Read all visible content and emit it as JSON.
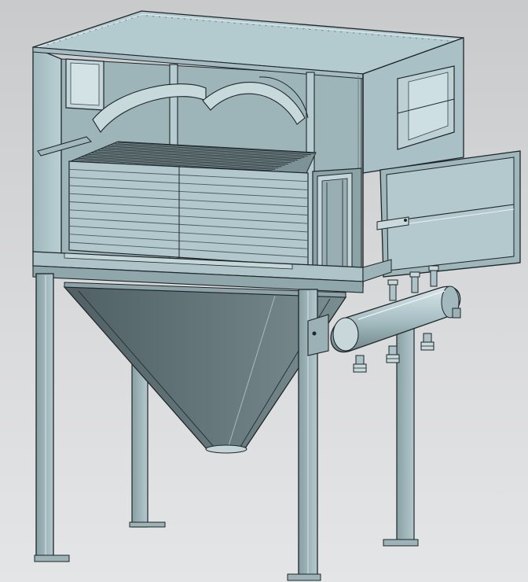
{
  "viewport": {
    "background_top": "#c9cacc",
    "background_bottom": "#e4e5e7"
  },
  "model": {
    "body_color": "#a9c3c8",
    "panel_color": "#b7ccd1",
    "dark_color": "#58686c",
    "outline_color": "#1e2628",
    "light_color": "#d6e5e8"
  }
}
